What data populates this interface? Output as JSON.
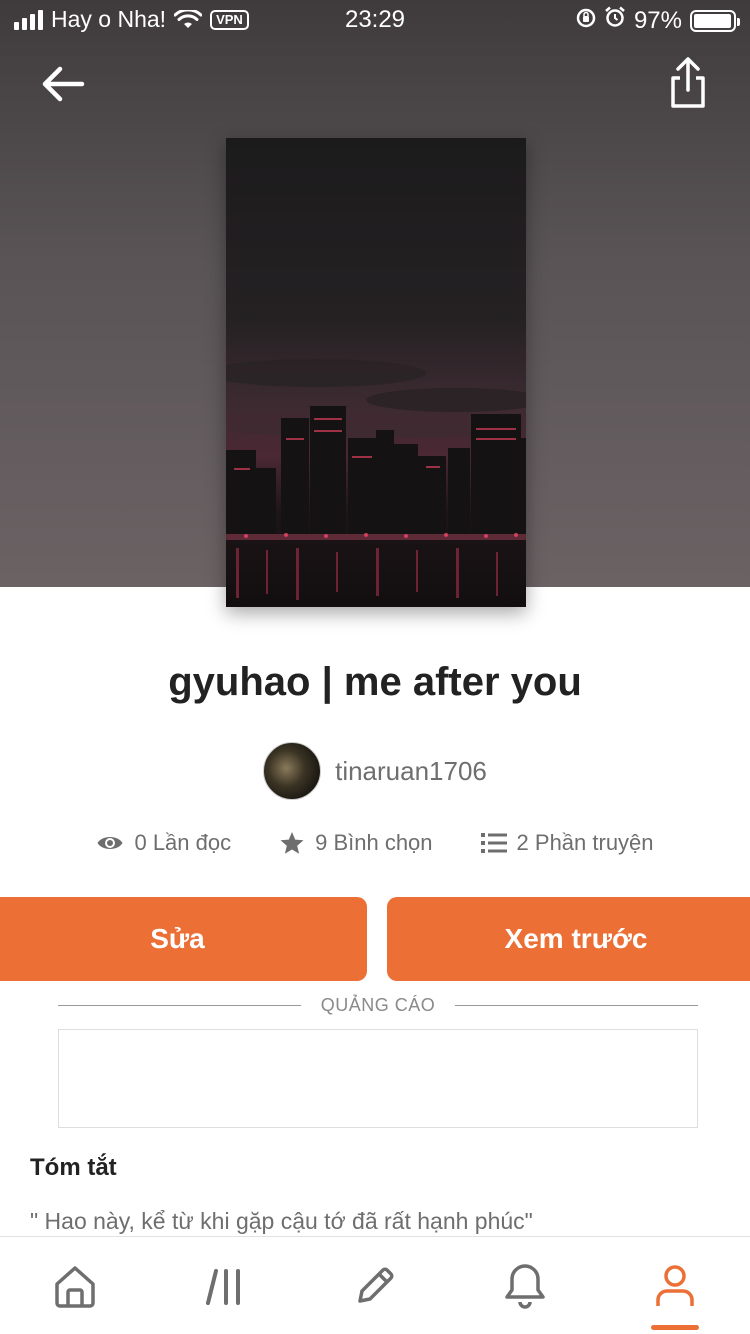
{
  "status_bar": {
    "carrier": "Hay o Nha!",
    "vpn": "VPN",
    "time": "23:29",
    "battery": "97%",
    "battery_level": 0.97
  },
  "header": {
    "back_icon": "arrow-left-icon",
    "share_icon": "share-icon"
  },
  "story": {
    "title": "gyuhao | me after you",
    "author": "tinaruan1706",
    "stats": {
      "reads": "0 Lần đọc",
      "votes": "9 Bình chọn",
      "parts": "2 Phần truyện"
    }
  },
  "actions": {
    "edit_label": "Sửa",
    "preview_label": "Xem trước"
  },
  "ad": {
    "label": "QUẢNG CÁO"
  },
  "summary": {
    "heading": "Tóm tắt",
    "text": "\" Hao này, kể từ khi gặp cậu tớ đã rất hạnh phúc\""
  },
  "tabbar": {
    "tabs": [
      {
        "icon": "home-icon",
        "active": false
      },
      {
        "icon": "library-icon",
        "active": false
      },
      {
        "icon": "pencil-icon",
        "active": false
      },
      {
        "icon": "bell-icon",
        "active": false
      },
      {
        "icon": "profile-icon",
        "active": true
      }
    ]
  },
  "colors": {
    "accent": "#ec6f36",
    "text_dark": "#222222",
    "text_muted": "#6e6e6e"
  }
}
